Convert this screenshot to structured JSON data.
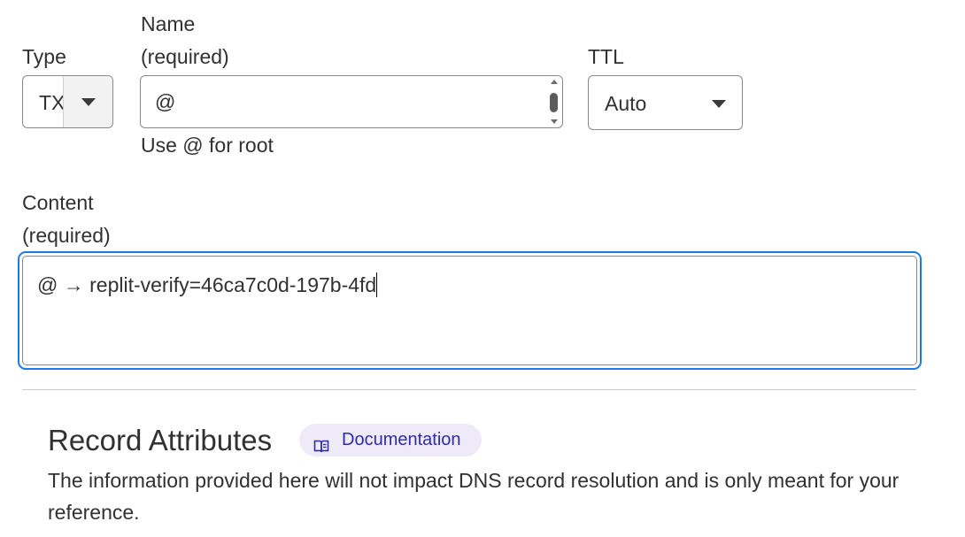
{
  "form": {
    "type": {
      "label": "Type",
      "value": "TXT"
    },
    "name": {
      "label_line1": "Name",
      "label_line2": "(required)",
      "value": "@",
      "help": "Use @ for root"
    },
    "ttl": {
      "label": "TTL",
      "value": "Auto"
    },
    "content": {
      "label_line1": "Content",
      "label_line2": "(required)",
      "value": "@ → replit-verify=46ca7c0d-197b-4fd"
    }
  },
  "record_attributes": {
    "title": "Record Attributes",
    "doc_link": "Documentation",
    "description": "The information provided here will not impact DNS record resolution and is only meant for your reference."
  },
  "colors": {
    "focus_ring": "#1a7ae8",
    "doc_pill_bg": "#eeeaf8",
    "doc_pill_text": "#2f2ca8"
  },
  "icons": {
    "select_caret": "caret-down-icon",
    "doc_link": "book-icon"
  }
}
